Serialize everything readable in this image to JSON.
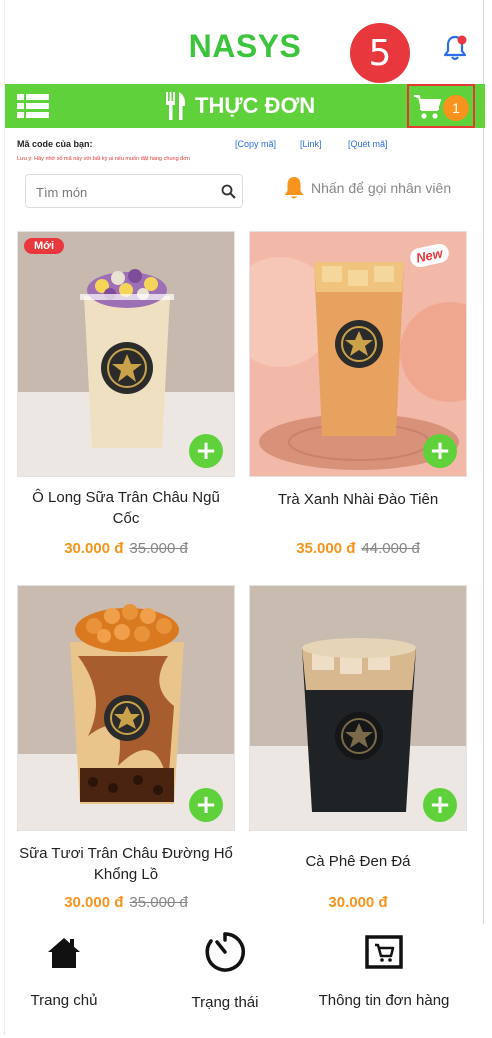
{
  "header": {
    "brand": "NASYS",
    "step_number": "5",
    "notification_icon": "bell-icon"
  },
  "menubar": {
    "title": "THỰC ĐƠN",
    "menu_icon": "list-icon",
    "title_icon": "fork-knife-icon",
    "cart_icon": "cart-icon",
    "cart_count": "1"
  },
  "code_section": {
    "label": "Mã code của bạn:",
    "copy_link": "[Copy mã]",
    "link_link": "[Link]",
    "scan_link": "[Quét mã]",
    "note": "Lưu ý: Hãy nhớ số mã này với bất kỳ ai nếu muốn đặt hàng chung đơn"
  },
  "search": {
    "placeholder": "Tìm món"
  },
  "call_staff": {
    "label": "Nhấn để gọi nhân viên"
  },
  "products": [
    {
      "name": "Ô Long Sữa Trân Châu Ngũ Cốc",
      "price": "30.000 đ",
      "old_price": "35.000 đ",
      "badge": "Mới"
    },
    {
      "name": "Trà Xanh Nhài Đào Tiên",
      "price": "35.000 đ",
      "old_price": "44.000 đ",
      "badge": "New"
    },
    {
      "name": "Sữa Tươi Trân Châu Đường Hổ Khổng Lồ",
      "price": "30.000 đ",
      "old_price": "35.000 đ"
    },
    {
      "name": "Cà Phê Đen Đá",
      "price": "30.000 đ"
    }
  ],
  "bottom_nav": {
    "home": "Trang chủ",
    "status": "Trạng thái",
    "order_info": "Thông tin đơn hàng"
  },
  "colors": {
    "brand_green": "#3cc43c",
    "bar_green": "#5fd13b",
    "price_orange": "#f7941d",
    "alert_red": "#e8383d"
  }
}
